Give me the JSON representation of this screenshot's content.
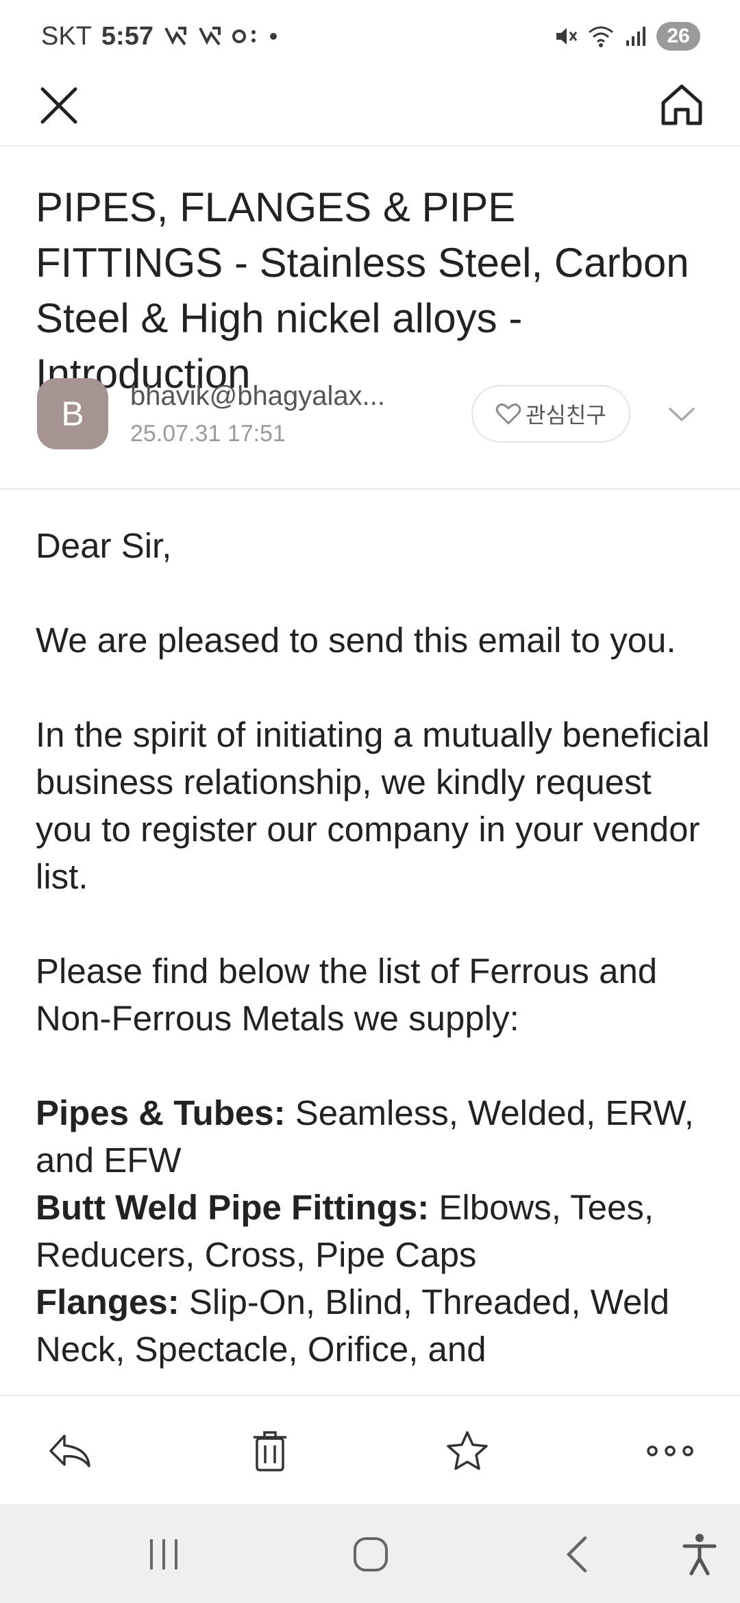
{
  "status_bar": {
    "carrier": "SKT",
    "time": "5:57",
    "battery": "26",
    "icons": [
      "missed-call-icon",
      "missed-call-icon",
      "voicemail-icon",
      "dot-icon",
      "mute-icon",
      "wifi-icon",
      "signal-icon"
    ]
  },
  "nav": {
    "close_icon": "close-icon",
    "home_icon": "home-icon"
  },
  "email": {
    "subject": "PIPES, FLANGES & PIPE FITTINGS - Stainless Steel, Carbon Steel & High nickel alloys - Introduction",
    "avatar_letter": "B",
    "sender": "bhavik@bhagyalax...",
    "date": "25.07.31 17:51",
    "favorite_label": "관심친구",
    "body": {
      "greeting": "Dear Sir,",
      "para1": "We are pleased to send this email to you.",
      "para2": "In the spirit of initiating a mutually beneficial business relationship, we kindly request you to register our company in your vendor list.",
      "para3": "Please find below the list of Ferrous and Non-Ferrous Metals we supply:",
      "items": [
        {
          "label": "Pipes & Tubes:",
          "text": " Seamless, Welded, ERW, and EFW"
        },
        {
          "label": "Butt Weld Pipe Fittings:",
          "text": " Elbows, Tees, Reducers, Cross, Pipe Caps"
        },
        {
          "label": "Flanges:",
          "text": " Slip-On, Blind, Threaded, Weld Neck, Spectacle, Orifice, and"
        }
      ]
    }
  },
  "toolbar": [
    "reply-icon",
    "delete-icon",
    "star-icon",
    "more-icon"
  ],
  "system_nav": [
    "recent-apps-icon",
    "home-circle-icon",
    "back-icon",
    "accessibility-icon"
  ],
  "colors": {
    "avatar": "#a69492",
    "battery": "#9a9a9a",
    "text": "#222222",
    "muted": "#9a9a9a"
  }
}
